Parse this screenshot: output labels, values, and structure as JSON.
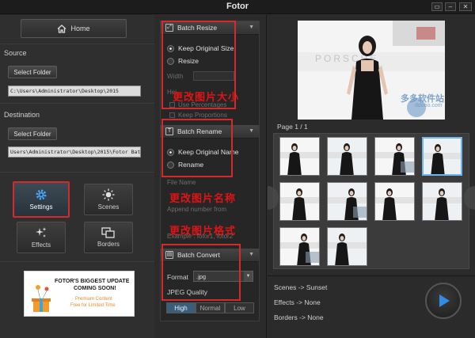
{
  "window": {
    "title": "Fotor"
  },
  "left": {
    "home_label": "Home",
    "source": {
      "label": "Source",
      "button": "Select Folder",
      "path": "C:\\Users\\Administrator\\Desktop\\2015"
    },
    "destination": {
      "label": "Destination",
      "button": "Select Folder",
      "path": "Users\\Administrator\\Desktop\\2015\\Fotor Batch"
    },
    "tools": [
      {
        "label": "Settings",
        "icon": "gear-icon",
        "active": true
      },
      {
        "label": "Scenes",
        "icon": "sun-icon",
        "active": false
      },
      {
        "label": "Effects",
        "icon": "sparkle-icon",
        "active": false
      },
      {
        "label": "Borders",
        "icon": "frames-icon",
        "active": false
      }
    ],
    "ad": {
      "line1": "FOTOR'S BIGGEST UPDATE",
      "line2": "COMING SOON!",
      "line3": "Premium Content",
      "line4": "Free for Limited Time"
    }
  },
  "middle": {
    "resize": {
      "title": "Batch Resize",
      "opt_keep": "Keep Original Size",
      "opt_resize": "Resize",
      "width_label": "Width",
      "height_label": "Hei",
      "use_pct": "Use Percentages",
      "keep_prop": "Keep Proportions",
      "annotation": "更改图片大小"
    },
    "rename": {
      "title": "Batch Rename",
      "opt_keep": "Keep Original Name",
      "opt_rename": "Rename",
      "file_name": "File Name",
      "append": "Append number from",
      "example": "Example : fotor1, fotor2",
      "annotation_name": "更改图片名称",
      "annotation_format": "更改图片格式"
    },
    "convert": {
      "title": "Batch Convert",
      "format_label": "Format",
      "format_value": ".jpg",
      "quality_label": "JPEG Quality",
      "quality_options": [
        "High",
        "Normal",
        "Low"
      ],
      "quality_selected": "High"
    }
  },
  "right": {
    "page_label": "Page 1 / 1",
    "watermark": "多多软件站",
    "watermark_url": "ddooo.com",
    "scenes": "Scenes -> Sunset",
    "effects": "Effects -> None",
    "borders": "Borders -> None",
    "thumb_count": 10,
    "selected_thumb": 4
  },
  "colors": {
    "accent_red": "#d42a2a",
    "accent_blue": "#2f8de4",
    "select_blue": "#6fb5ee"
  }
}
